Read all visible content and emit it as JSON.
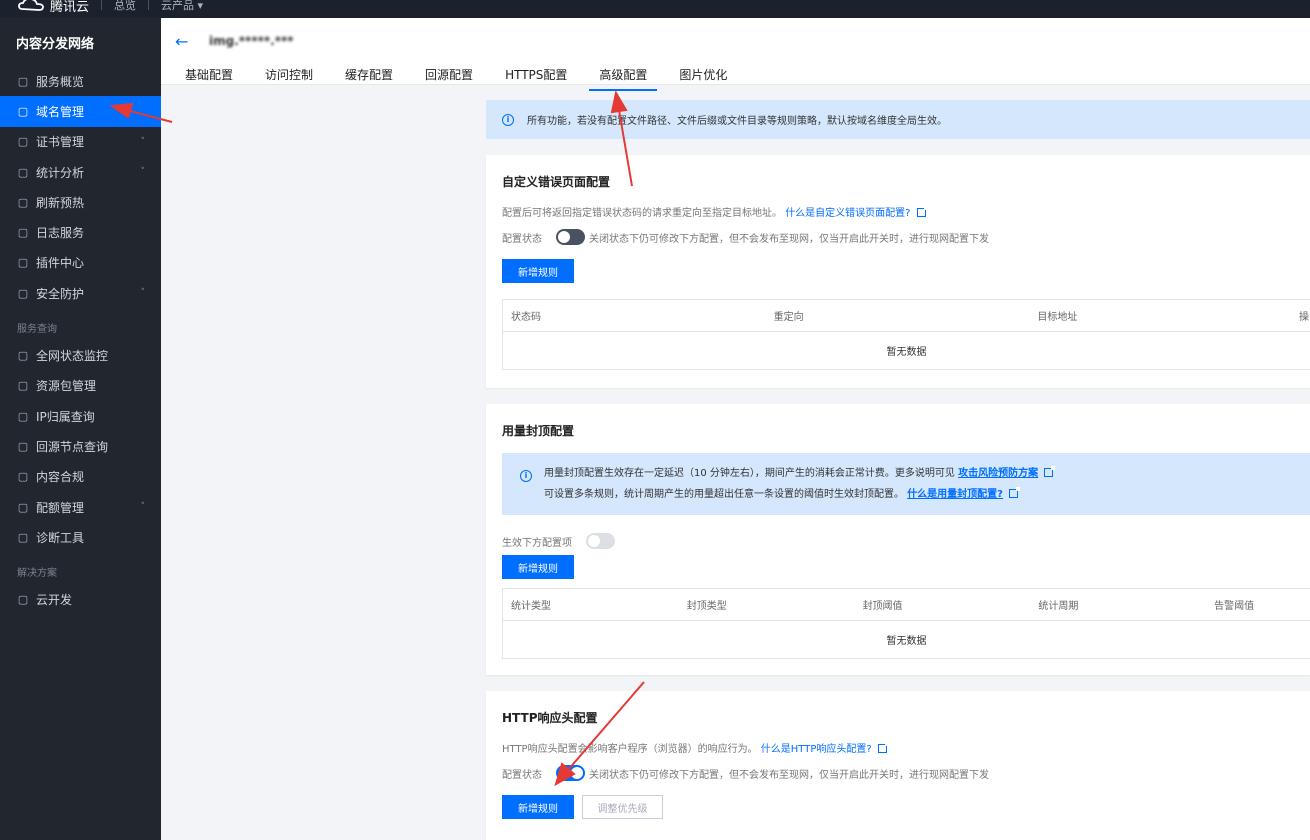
{
  "topbar": {
    "brand": "腾讯云",
    "overview": "总览",
    "products": "云产品 ▾"
  },
  "sidebar": {
    "title": "内容分发网络",
    "items": [
      {
        "label": "服务概览",
        "icon": "grid-icon",
        "chev": ""
      },
      {
        "label": "域名管理",
        "icon": "domain-icon",
        "chev": ""
      },
      {
        "label": "证书管理",
        "icon": "certificate-icon",
        "chev": "˅"
      },
      {
        "label": "统计分析",
        "icon": "bar-chart-icon",
        "chev": "˅"
      },
      {
        "label": "刷新预热",
        "icon": "refresh-icon",
        "chev": ""
      },
      {
        "label": "日志服务",
        "icon": "log-icon",
        "chev": ""
      },
      {
        "label": "插件中心",
        "icon": "plugin-icon",
        "chev": ""
      },
      {
        "label": "安全防护",
        "icon": "shield-icon",
        "chev": "˅"
      }
    ],
    "group1": "服务查询",
    "items2": [
      {
        "label": "全网状态监控",
        "icon": "monitor-icon",
        "chev": ""
      },
      {
        "label": "资源包管理",
        "icon": "package-icon",
        "chev": ""
      },
      {
        "label": "IP归属查询",
        "icon": "ip-icon",
        "chev": ""
      },
      {
        "label": "回源节点查询",
        "icon": "search-node-icon",
        "chev": ""
      },
      {
        "label": "内容合规",
        "icon": "image-icon",
        "chev": ""
      },
      {
        "label": "配额管理",
        "icon": "pie-icon",
        "chev": "˅"
      },
      {
        "label": "诊断工具",
        "icon": "diagnose-icon",
        "chev": ""
      }
    ],
    "group2": "解决方案",
    "items3": [
      {
        "label": "云开发",
        "icon": "cloud-dev-icon",
        "chev": ""
      }
    ]
  },
  "header": {
    "domain": "img.*****.***",
    "tabs": [
      "基础配置",
      "访问控制",
      "缓存配置",
      "回源配置",
      "HTTPS配置",
      "高级配置",
      "图片优化"
    ]
  },
  "notice": "所有功能，若没有配置文件路径、文件后缀或文件目录等规则策略，默认按域名维度全局生效。",
  "error_page": {
    "title": "自定义错误页面配置",
    "desc": "配置后可将返回指定错误状态码的请求重定向至指定目标地址。",
    "link": "什么是自定义错误页面配置?",
    "status_label": "配置状态",
    "status_hint": "关闭状态下仍可修改下方配置，但不会发布至现网，仅当开启此开关时，进行现网配置下发",
    "add_button": "新增规则",
    "columns": [
      "状态码",
      "重定向",
      "目标地址",
      "操"
    ],
    "empty": "暂无数据"
  },
  "usage_cap": {
    "title": "用量封顶配置",
    "notice_line1": "用量封顶配置生效存在一定延迟（10 分钟左右），期间产生的消耗会正常计费。更多说明可见",
    "notice_link1": "攻击风险预防方案",
    "notice_line2": "可设置多条规则，统计周期产生的用量超出任意一条设置的阈值时生效封顶配置。",
    "notice_link2": "什么是用量封顶配置?",
    "toggle_label": "生效下方配置项",
    "add_button": "新增规则",
    "columns": [
      "统计类型",
      "封顶类型",
      "封顶阈值",
      "统计周期",
      "告警阈值"
    ],
    "empty": "暂无数据"
  },
  "http_header": {
    "title": "HTTP响应头配置",
    "desc": "HTTP响应头配置会影响客户程序（浏览器）的响应行为。",
    "link": "什么是HTTP响应头配置?",
    "status_label": "配置状态",
    "status_hint": "关闭状态下仍可修改下方配置，但不会发布至现网，仅当开启此开关时，进行现网配置下发",
    "add_button": "新增规则",
    "priority_button": "调整优先级"
  },
  "colors": {
    "accent": "#006eff",
    "sidebar_bg": "#21262f",
    "annotation": "#e53935"
  }
}
